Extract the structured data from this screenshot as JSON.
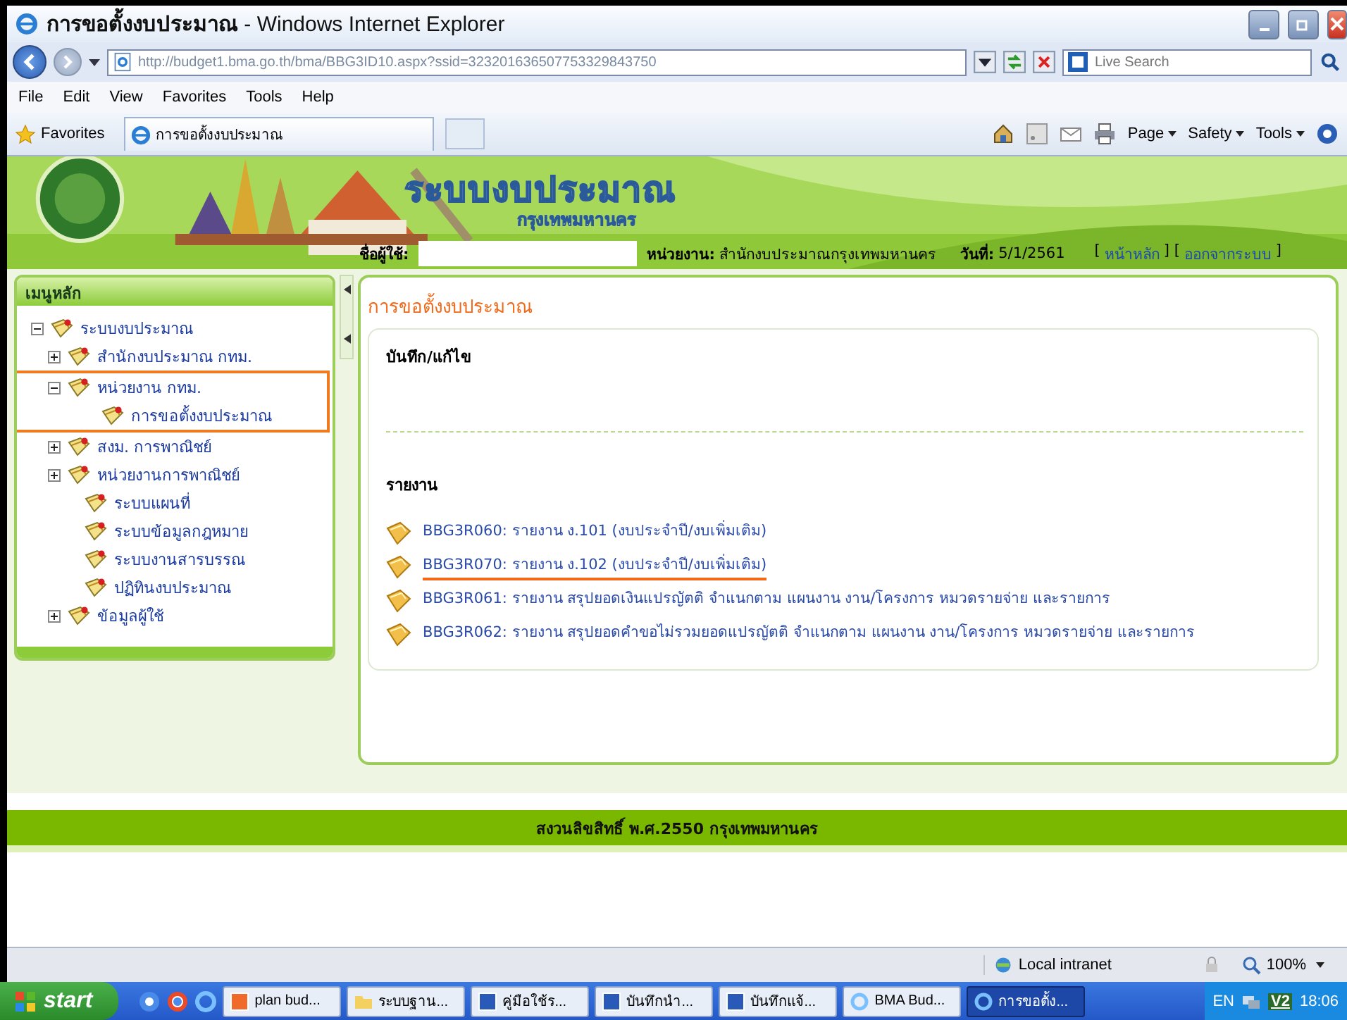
{
  "window": {
    "title": "**การขอตั้งงบประมาณ** - Windows Internet Explorer"
  },
  "address_bar": {
    "url": "http://budget1.bma.go.th/bma/BBG3ID10.aspx?ssid=323201636507753329843750",
    "search_placeholder": "Live Search"
  },
  "menu_bar": [
    "File",
    "Edit",
    "View",
    "Favorites",
    "Tools",
    "Help"
  ],
  "favorites_bar": {
    "favorites": "Favorites",
    "tab": "การขอตั้งงบประมาณ",
    "commands": [
      "Page",
      "Safety",
      "Tools"
    ]
  },
  "header": {
    "title": "ระบบงบประมาณ",
    "subtitle": "กรุงเทพมหานคร",
    "user_label": "ชื่อผู้ใช้:",
    "unit_label": "หน่วยงาน:",
    "unit": "สำนักงบประมาณกรุงเทพมหานคร",
    "date_label": "วันที่:",
    "date": "5/1/2561",
    "nav": {
      "open": "[",
      "separator": "] [",
      "close": "]",
      "links": [
        "หน้าหลัก",
        "ออกจากระบบ"
      ]
    }
  },
  "sidebar": {
    "title": "เมนูหลัก",
    "items": [
      {
        "label": "ระบบงบประมาณ",
        "expanded": true,
        "highlighted": false,
        "children": [
          {
            "label": "สำนักงบประมาณ กทม.",
            "expanded": false,
            "highlighted": false
          },
          {
            "label": "หน่วยงาน กทม.",
            "expanded": true,
            "highlighted": true,
            "children": [
              {
                "label": "การขอตั้งงบประมาณ"
              }
            ]
          },
          {
            "label": "สงม. การพาณิชย์",
            "expanded": false,
            "highlighted": false
          },
          {
            "label": "หน่วยงานการพาณิชย์",
            "expanded": false,
            "highlighted": false
          },
          {
            "label": "ระบบแผนที่",
            "highlighted": false
          },
          {
            "label": "ระบบข้อมูลกฎหมาย",
            "highlighted": false
          },
          {
            "label": "ระบบงานสารบรรณ",
            "highlighted": false
          },
          {
            "label": "ปฏิทินงบประมาณ",
            "highlighted": false
          },
          {
            "label": "ข้อมูลผู้ใช้",
            "expanded": false,
            "highlighted": false
          }
        ]
      }
    ]
  },
  "content": {
    "title": "การขอตั้งงบประมาณ",
    "edit_heading": "บันทึก/แก้ไข",
    "report_heading": "รายงาน",
    "reports": [
      {
        "label": "BBG3R060: รายงาน ง.101 (งบประจำปี/งบเพิ่มเติม)",
        "underlined": false
      },
      {
        "label": "BBG3R070: รายงาน ง.102 (งบประจำปี/งบเพิ่มเติม)",
        "underlined": true
      },
      {
        "label": "BBG3R061: รายงาน สรุปยอดเงินแปรญัตติ จำแนกตาม แผนงาน งาน/โครงการ หมวดรายจ่าย และรายการ",
        "underlined": false
      },
      {
        "label": "BBG3R062: รายงาน สรุปยอดคำขอไม่รวมยอดแปรญัตติ จำแนกตาม แผนงาน งาน/โครงการ หมวดรายจ่าย และรายการ",
        "underlined": false
      }
    ]
  },
  "footer": "สงวนลิขสิทธิ์ พ.ศ.2550 กรุงเทพมหานคร",
  "status_bar": {
    "zone": "Local intranet",
    "zoom": "100%"
  },
  "taskbar": {
    "start": "start",
    "items": [
      {
        "label": "plan bud...",
        "kind": "ppt",
        "selected": false
      },
      {
        "label": "ระบบฐาน...",
        "kind": "folder",
        "selected": false
      },
      {
        "label": "คู่มือใช้ร...",
        "kind": "word",
        "selected": false
      },
      {
        "label": "บันทึกนำ...",
        "kind": "word",
        "selected": false
      },
      {
        "label": "บันทึกแจ้...",
        "kind": "word",
        "selected": false
      },
      {
        "label": "BMA Bud...",
        "kind": "ie",
        "selected": false
      },
      {
        "label": "การขอตั้ง...",
        "kind": "ie",
        "selected": true
      }
    ],
    "language": "EN",
    "tray_badge": "V2",
    "clock": "18:06"
  }
}
